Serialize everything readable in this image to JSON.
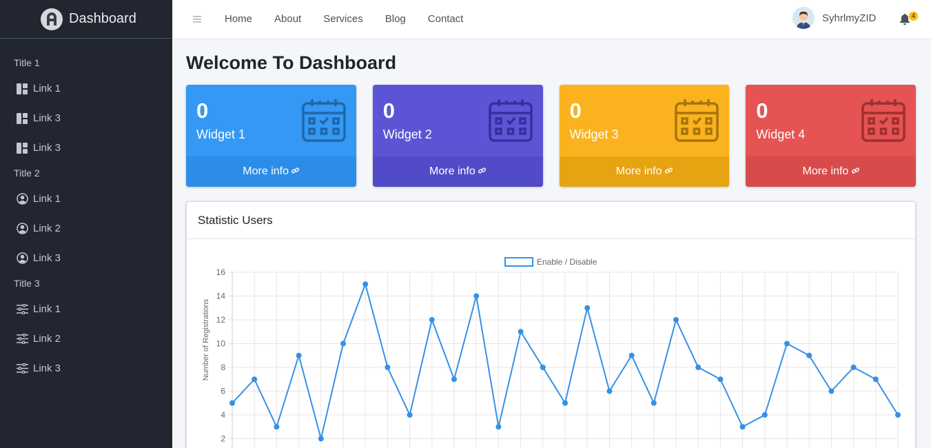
{
  "brand": {
    "name": "Dashboard"
  },
  "sidebar": {
    "sections": [
      {
        "title": "Title 1",
        "icon": "layout-icon",
        "items": [
          "Link 1",
          "Link 3",
          "Link 3"
        ]
      },
      {
        "title": "Title 2",
        "icon": "user-circle-icon",
        "items": [
          "Link 1",
          "Link 2",
          "Link 3"
        ]
      },
      {
        "title": "Title 3",
        "icon": "sliders-icon",
        "items": [
          "Link 1",
          "Link 2",
          "Link 3"
        ]
      }
    ]
  },
  "topbar": {
    "menu_icon": "hamburger-icon",
    "nav": [
      "Home",
      "About",
      "Services",
      "Blog",
      "Contact"
    ],
    "username": "SyhrlmyZID",
    "notification_count": "4"
  },
  "page": {
    "title": "Welcome To Dashboard"
  },
  "widgets": [
    {
      "value": "0",
      "label": "Widget 1",
      "more": "More info",
      "color": "#3498f4",
      "footer_color": "#2b8de8",
      "icon_color": "#1f67a8"
    },
    {
      "value": "0",
      "label": "Widget 2",
      "more": "More info",
      "color": "#5b55d6",
      "footer_color": "#514bc8",
      "icon_color": "#34309a"
    },
    {
      "value": "0",
      "label": "Widget 3",
      "more": "More info",
      "color": "#fab31e",
      "footer_color": "#e6a312",
      "icon_color": "#a87409"
    },
    {
      "value": "0",
      "label": "Widget 4",
      "more": "More info",
      "color": "#e55353",
      "footer_color": "#d84b4b",
      "icon_color": "#9e2f2f"
    }
  ],
  "stat_card": {
    "title": "Statistic Users"
  },
  "chart_data": {
    "type": "line",
    "legend": [
      "Enable / Disable"
    ],
    "ylabel": "Number of Registrations",
    "y_ticks": [
      2,
      4,
      6,
      8,
      10,
      12,
      14,
      16
    ],
    "ylim": [
      0,
      16
    ],
    "color": "#3490e8",
    "series": [
      {
        "name": "Enable / Disable",
        "values": [
          5,
          7,
          3,
          9,
          2,
          10,
          15,
          8,
          4,
          12,
          7,
          14,
          3,
          11,
          8,
          5,
          13,
          6,
          9,
          5,
          12,
          8,
          7,
          3,
          4,
          10,
          9,
          6,
          8,
          7,
          4
        ]
      }
    ]
  }
}
